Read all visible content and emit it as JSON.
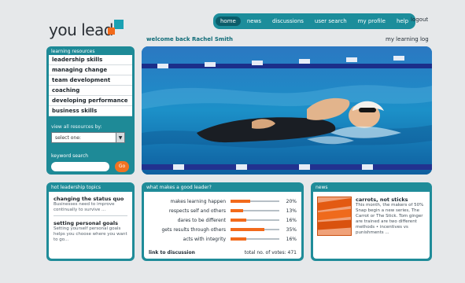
{
  "brand": {
    "name": "you lead",
    "accent": "#1aa1b3",
    "accent2": "#f26a1b"
  },
  "topnav": {
    "items": [
      {
        "label": "home",
        "active": true
      },
      {
        "label": "news",
        "active": false
      },
      {
        "label": "discussions",
        "active": false
      },
      {
        "label": "user search",
        "active": false
      },
      {
        "label": "my profile",
        "active": false
      },
      {
        "label": "help",
        "active": false
      }
    ],
    "logout": "logout"
  },
  "welcome": "welcome back Rachel Smith",
  "my_learning_log": "my learning log",
  "sidebar": {
    "title": "learning resources",
    "items": [
      "leadership skills",
      "managing change",
      "team development",
      "coaching",
      "developing performance",
      "business skills"
    ],
    "view_all_label": "view all resources by:",
    "select_value": "select one:",
    "keyword_label": "keyword search",
    "keyword_placeholder": "",
    "go_label": "Go"
  },
  "hero": {
    "alt": "swimmer"
  },
  "hot_topics": {
    "title": "hot leadership topics",
    "stories": [
      {
        "heading": "changing the status quo",
        "body": "Businesses need to improve continually to survive ..."
      },
      {
        "heading": "setting personal goals",
        "body": "Setting yourself personal goals helps you choose where you want to go..."
      }
    ]
  },
  "poll": {
    "title": "what makes a good leader?",
    "rows": [
      {
        "label": "makes learning happen",
        "value": 20,
        "pct": "20%"
      },
      {
        "label": "respects self and others",
        "value": 13,
        "pct": "13%"
      },
      {
        "label": "dares to be different",
        "value": 16,
        "pct": "16%"
      },
      {
        "label": "gets results through others",
        "value": 35,
        "pct": "35%"
      },
      {
        "label": "acts with integrity",
        "value": 16,
        "pct": "16%"
      }
    ],
    "link": "link to discussion",
    "total": "total no. of votes: 471"
  },
  "news": {
    "title": "news",
    "heading": "carrots, not sticks",
    "body": "This month, the makers of 50% Snap begin a new series, The Carrot or The Stick. Tom ginger are trained are two different methods • incentives vs punishments ..."
  }
}
